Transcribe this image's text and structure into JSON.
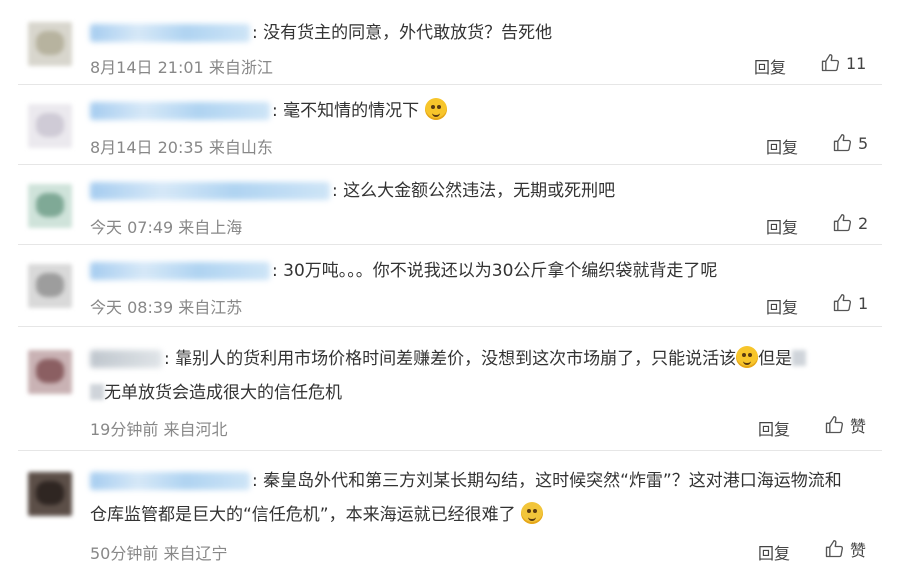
{
  "comments": [
    {
      "text": ": 没有货主的同意，外代敢放货？告死他",
      "meta": "8月14日 21:01 来自浙江",
      "reply": "回复",
      "likes": "11"
    },
    {
      "text": ": 毫不知情的情况下",
      "meta": "8月14日 20:35 来自山东",
      "reply": "回复",
      "likes": "5"
    },
    {
      "text": ": 这么大金额公然违法，无期或死刑吧",
      "meta": "今天 07:49 来自上海",
      "reply": "回复",
      "likes": "2"
    },
    {
      "text": ": 30万吨。。。你不说我还以为30公斤拿个编织袋就背走了呢",
      "meta": "今天 08:39 来自江苏",
      "reply": "回复",
      "likes": "1"
    },
    {
      "text": ": 靠别人的货利用市场价格时间差赚差价，没想到这次市场崩了，只能说活该",
      "text_b": "但是",
      "text2": "无单放货会造成很大的信任危机",
      "meta": "19分钟前 来自河北",
      "reply": "回复",
      "likes": "赞"
    },
    {
      "text": ": 秦皇岛外代和第三方刘某长期勾结，这时候突然“炸雷”？这对港口海运物流和",
      "text2": "仓库监管都是巨大的“信任危机”，本来海运就已经很难了",
      "meta": "50分钟前 来自辽宁",
      "reply": "回复",
      "likes": "赞"
    }
  ],
  "icons": {
    "thumb": "thumbs-up-icon",
    "emoji": "emoji-icon"
  }
}
